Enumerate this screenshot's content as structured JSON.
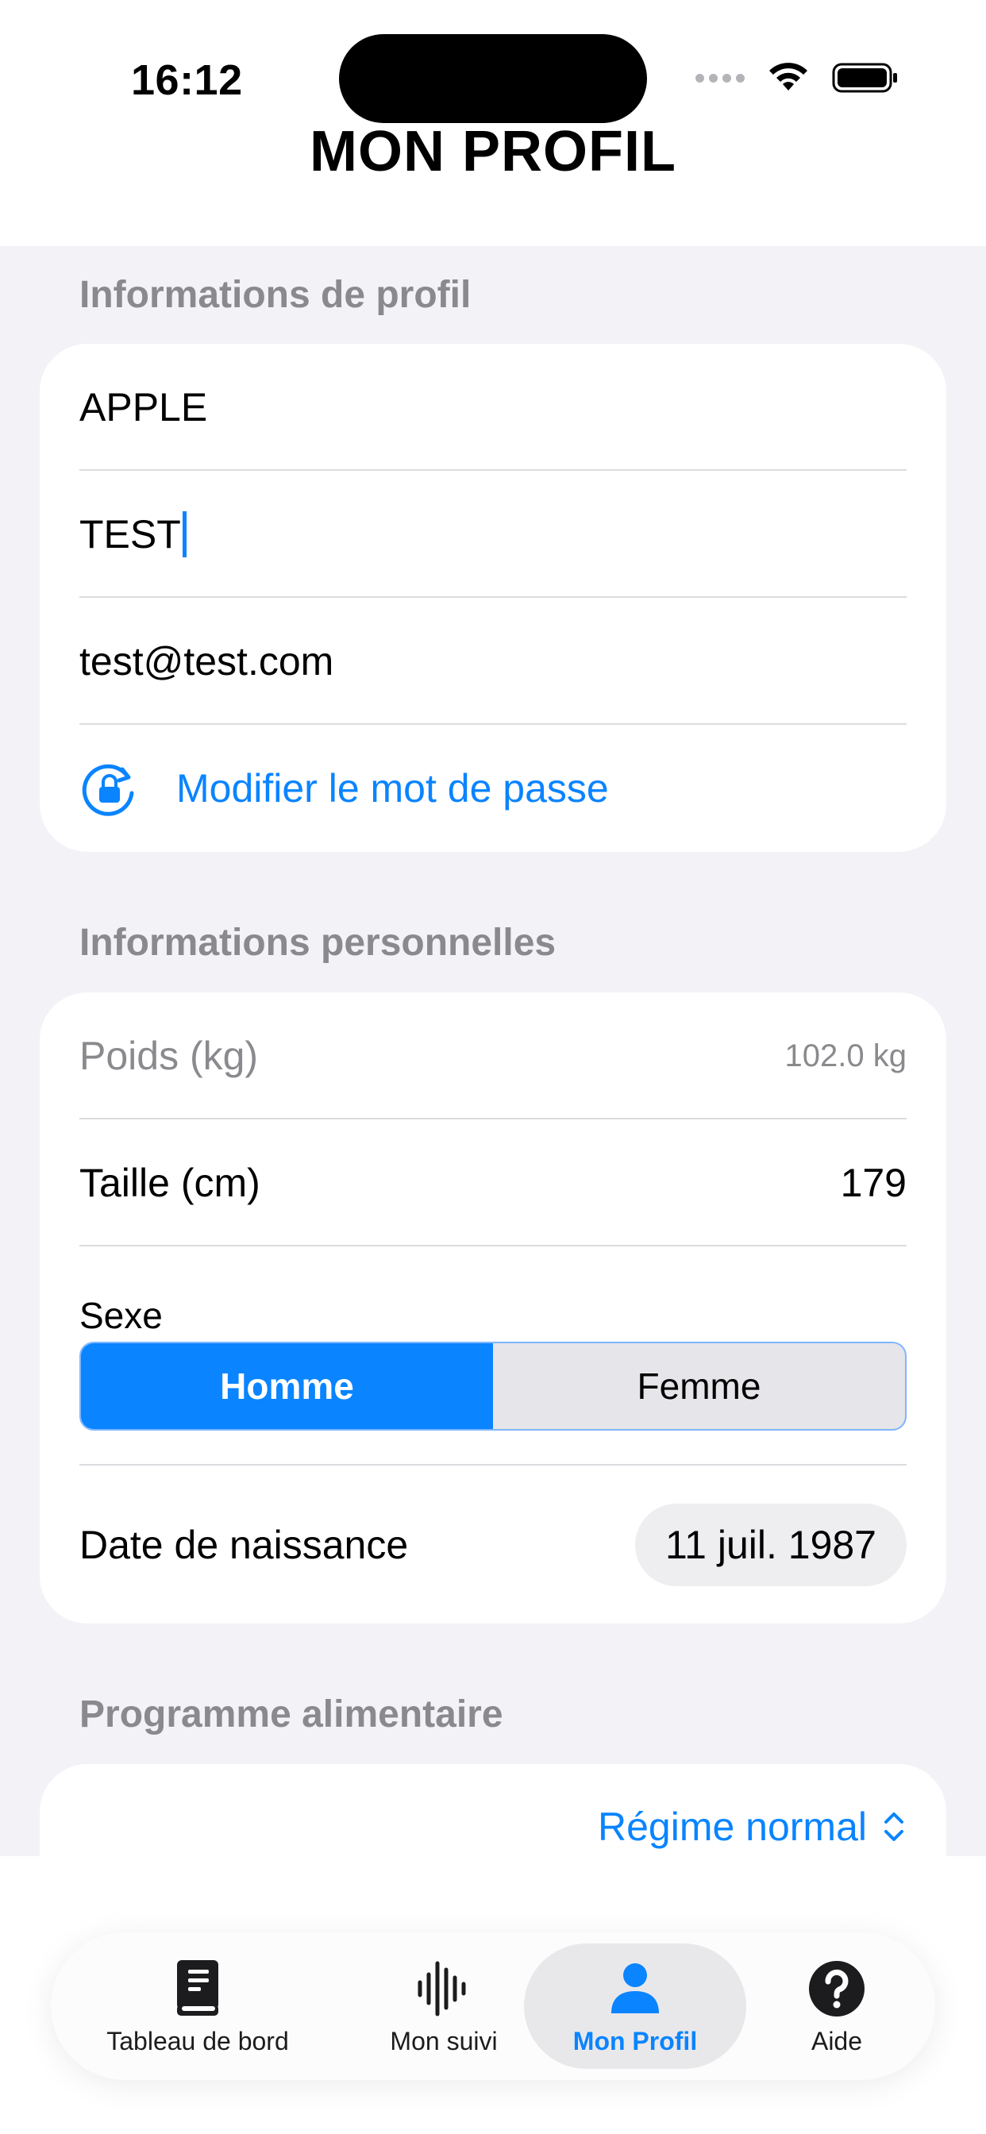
{
  "status_bar": {
    "time": "16:12"
  },
  "page": {
    "title": "MON PROFIL"
  },
  "profile_section": {
    "title": "Informations de profil",
    "last_name": "APPLE",
    "first_name": "TEST",
    "email": "test@test.com",
    "change_password_label": "Modifier le mot de passe"
  },
  "personal_section": {
    "title": "Informations personnelles",
    "weight_label": "Poids (kg)",
    "weight_value": "102.0 kg",
    "height_label": "Taille (cm)",
    "height_value": "179",
    "sex_label": "Sexe",
    "sex_options": [
      "Homme",
      "Femme"
    ],
    "sex_selected": "Homme",
    "birthdate_label": "Date de naissance",
    "birthdate_value": "11 juil. 1987"
  },
  "diet_section": {
    "title": "Programme alimentaire",
    "selected": "Régime normal"
  },
  "tab_bar": {
    "items": [
      {
        "label": "Tableau de bord",
        "icon": "book-icon"
      },
      {
        "label": "Mon suivi",
        "icon": "waveform-icon"
      },
      {
        "label": "Mon Profil",
        "icon": "person-icon"
      },
      {
        "label": "Aide",
        "icon": "question-icon"
      }
    ],
    "active": "Mon Profil"
  },
  "colors": {
    "accent": "#0a84ff",
    "background": "#f2f2f7",
    "section_title": "#8a8a8e"
  }
}
